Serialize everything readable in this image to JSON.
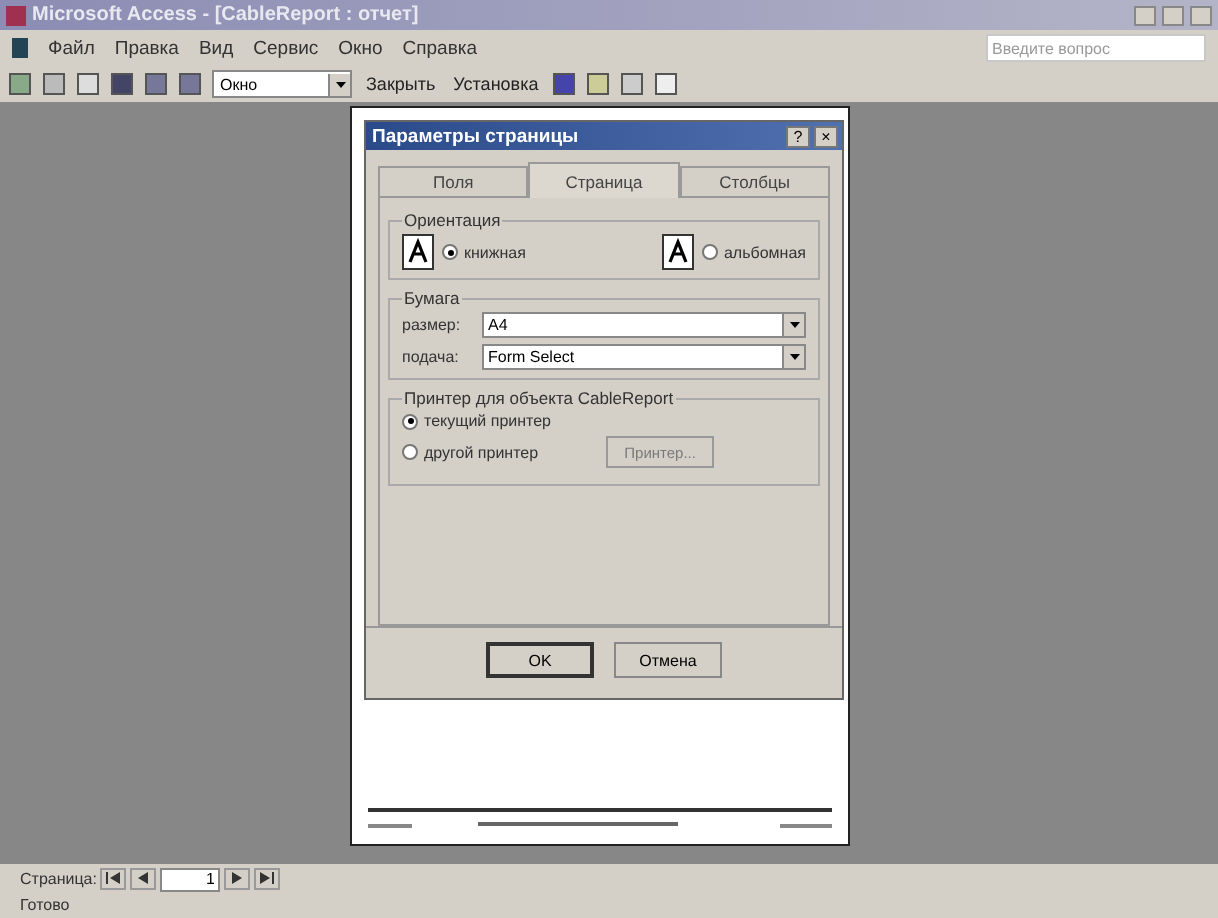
{
  "window": {
    "title": "Microsoft Access - [CableReport : отчет]"
  },
  "menu": [
    "Файл",
    "Правка",
    "Вид",
    "Сервис",
    "Окно",
    "Справка"
  ],
  "help_box": {
    "placeholder": "Введите вопрос"
  },
  "toolbar": {
    "zoom": "Окно",
    "buttons": [
      "Закрыть",
      "Установка"
    ]
  },
  "dialog": {
    "title": "Параметры страницы",
    "help": "?",
    "close": "×",
    "tabs": [
      {
        "label": "Поля",
        "selected": false
      },
      {
        "label": "Страница",
        "selected": true
      },
      {
        "label": "Столбцы",
        "selected": false
      }
    ],
    "orientation": {
      "legend": "Ориентация",
      "options": [
        {
          "label": "книжная",
          "selected": true
        },
        {
          "label": "альбомная",
          "selected": false
        }
      ]
    },
    "paper": {
      "legend": "Бумага",
      "fields": [
        {
          "label": "размер:",
          "value": "A4"
        },
        {
          "label": "подача:",
          "value": "Form Select"
        }
      ]
    },
    "printer": {
      "legend": "Принтер для объекта CableReport",
      "options": [
        {
          "label": "текущий принтер",
          "selected": true
        },
        {
          "label": "другой принтер",
          "selected": false
        }
      ],
      "button": {
        "label": "Принтер...",
        "disabled": true
      }
    },
    "buttons": [
      "OK",
      "Отмена"
    ]
  },
  "navigation": {
    "label": "Страница:",
    "page": "1"
  },
  "status_bar": "Готово"
}
